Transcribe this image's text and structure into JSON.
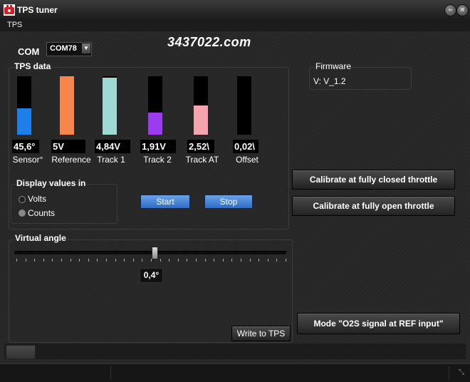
{
  "window": {
    "title": "TPS tuner",
    "minimize_icon": "minimize-icon",
    "close_icon": "close-icon"
  },
  "menu": {
    "items": [
      "TPS"
    ]
  },
  "watermark": "3437022.com",
  "com": {
    "label": "COM",
    "value": "COM78"
  },
  "tps_data": {
    "title": "TPS data",
    "bars": [
      {
        "label": "Sensor°",
        "value": "45,6°",
        "color": "#1e7fe8",
        "level": 0.45
      },
      {
        "label": "Reference",
        "value": "5V",
        "color": "#f7864c",
        "level": 1.0
      },
      {
        "label": "Track 1",
        "value": "4,84V",
        "color": "#9ed9d6",
        "level": 0.97
      },
      {
        "label": "Track 2",
        "value": "1,91V",
        "color": "#9b3cf0",
        "level": 0.38
      },
      {
        "label": "Track AT",
        "value": "2,52\\",
        "color": "#f4a4ac",
        "level": 0.5
      },
      {
        "label": "Offset",
        "value": "0,02\\",
        "color": "#111111",
        "level": 0.0
      }
    ]
  },
  "display_values": {
    "title": "Display values in",
    "options": [
      "Volts",
      "Counts"
    ],
    "selected": "Counts"
  },
  "buttons": {
    "start": "Start",
    "stop": "Stop",
    "calibrate_closed": "Calibrate at fully closed throttle",
    "calibrate_open": "Calibrate at fully open throttle",
    "write": "Write to TPS",
    "mode": "Mode \"O2S signal at REF input\""
  },
  "firmware": {
    "title": "Firmware",
    "value": "V:  V_1.2"
  },
  "virtual_angle": {
    "title": "Virtual angle",
    "value": "0,4°",
    "level": 0.5
  }
}
